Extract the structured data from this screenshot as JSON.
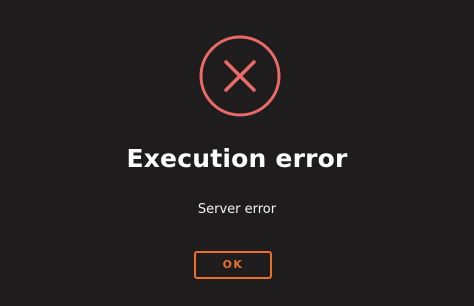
{
  "dialog": {
    "icon": "error-x-circle-icon",
    "title": "Execution error",
    "message": "Server error",
    "ok_label": "OK"
  },
  "colors": {
    "background": "#1e1c1c",
    "error_icon": "#e96a68",
    "title_text": "#ffffff",
    "message_text": "#f2f2f2",
    "button_accent": "#e8702a"
  }
}
